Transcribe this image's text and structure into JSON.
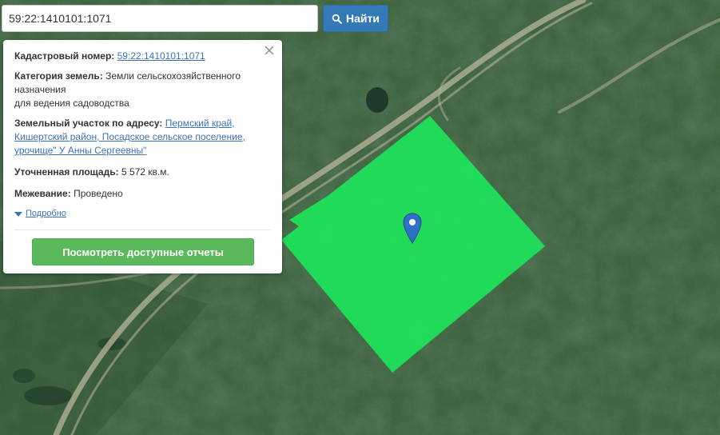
{
  "search": {
    "value": "59:22:1410101:1071",
    "button_label": "Найти"
  },
  "popup": {
    "cadastral_label": "Кадастровый номер:",
    "cadastral_value": "59:22:1410101:1071",
    "category_label": "Категория земель:",
    "category_value": "Земли сельскохозяйственного назначения",
    "category_use": "для ведения садоводства",
    "address_label": "Земельный участок по адресу:",
    "address_line1": "Пермский край,",
    "address_line2": "Кишертский район, Посадское сельское поселение,",
    "address_line3": "урочище\" У Анны Сергеевны\"",
    "area_label": "Уточненная площадь:",
    "area_value": "5 572 кв.м.",
    "survey_label": "Межевание:",
    "survey_value": "Проведено",
    "more_link": "Подробно",
    "report_button": "Посмотреть доступные отчеты"
  },
  "colors": {
    "parcel": "#1fe05a",
    "link": "#3b73b9",
    "search_button": "#337ab7",
    "report_button": "#5cb85c"
  },
  "icons": [
    "search-icon",
    "close-icon",
    "caret-down-icon",
    "map-pin-icon"
  ]
}
